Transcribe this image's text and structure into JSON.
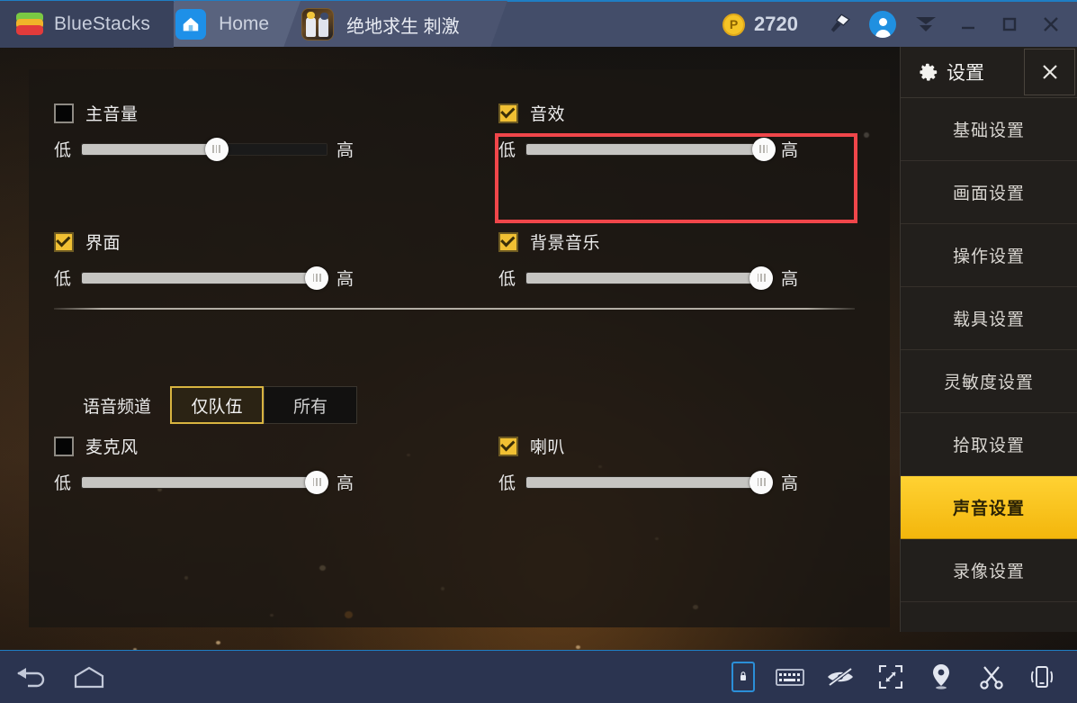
{
  "titlebar": {
    "brand": "BlueStacks",
    "brand_logo_icon": "bluestacks-logo-icon",
    "tabs": [
      {
        "label": "Home",
        "icon": "home-icon"
      },
      {
        "label": "绝地求生 刺激",
        "icon": "game-app-icon"
      }
    ],
    "points": {
      "icon": "coin-icon",
      "value": "2720"
    },
    "actions": [
      {
        "name": "brush-icon"
      },
      {
        "name": "user-avatar-icon"
      },
      {
        "name": "chevron-down-icon"
      },
      {
        "name": "minimize-icon"
      },
      {
        "name": "maximize-icon"
      },
      {
        "name": "close-icon"
      }
    ]
  },
  "settings_panel": {
    "controls": [
      {
        "id": "master-volume",
        "label": "主音量",
        "checked": false,
        "low": "低",
        "high": "高",
        "value": 55
      },
      {
        "id": "sound-effects",
        "label": "音效",
        "checked": true,
        "low": "低",
        "high": "高",
        "value": 97
      },
      {
        "id": "interface",
        "label": "界面",
        "checked": true,
        "low": "低",
        "high": "高",
        "value": 96
      },
      {
        "id": "background-music",
        "label": "背景音乐",
        "checked": true,
        "low": "低",
        "high": "高",
        "value": 96
      },
      {
        "id": "microphone",
        "label": "麦克风",
        "checked": false,
        "low": "低",
        "high": "高",
        "value": 96
      },
      {
        "id": "speaker",
        "label": "喇叭",
        "checked": true,
        "low": "低",
        "high": "高",
        "value": 96
      }
    ],
    "voice_channel": {
      "label": "语音频道",
      "options": [
        "仅队伍",
        "所有"
      ],
      "selected": "仅队伍"
    },
    "annotation": {
      "target": "音效",
      "color": "#f0464a"
    }
  },
  "sidebar": {
    "title": "设置",
    "title_icon": "gear-icon",
    "close_icon": "close-icon",
    "items": [
      {
        "label": "基础设置",
        "active": false
      },
      {
        "label": "画面设置",
        "active": false
      },
      {
        "label": "操作设置",
        "active": false
      },
      {
        "label": "载具设置",
        "active": false
      },
      {
        "label": "灵敏度设置",
        "active": false
      },
      {
        "label": "拾取设置",
        "active": false
      },
      {
        "label": "声音设置",
        "active": true
      },
      {
        "label": "录像设置",
        "active": false
      }
    ],
    "accent_color": "#f3b60c"
  },
  "bottombar": {
    "left_icons": [
      {
        "name": "back-icon"
      },
      {
        "name": "home-pentagon-icon"
      }
    ],
    "right_icons": [
      {
        "name": "phone-lock-icon",
        "highlighted": true
      },
      {
        "name": "keyboard-icon"
      },
      {
        "name": "eye-off-icon"
      },
      {
        "name": "fullscreen-icon"
      },
      {
        "name": "location-pin-icon"
      },
      {
        "name": "scissors-icon"
      },
      {
        "name": "shake-phone-icon"
      }
    ]
  }
}
